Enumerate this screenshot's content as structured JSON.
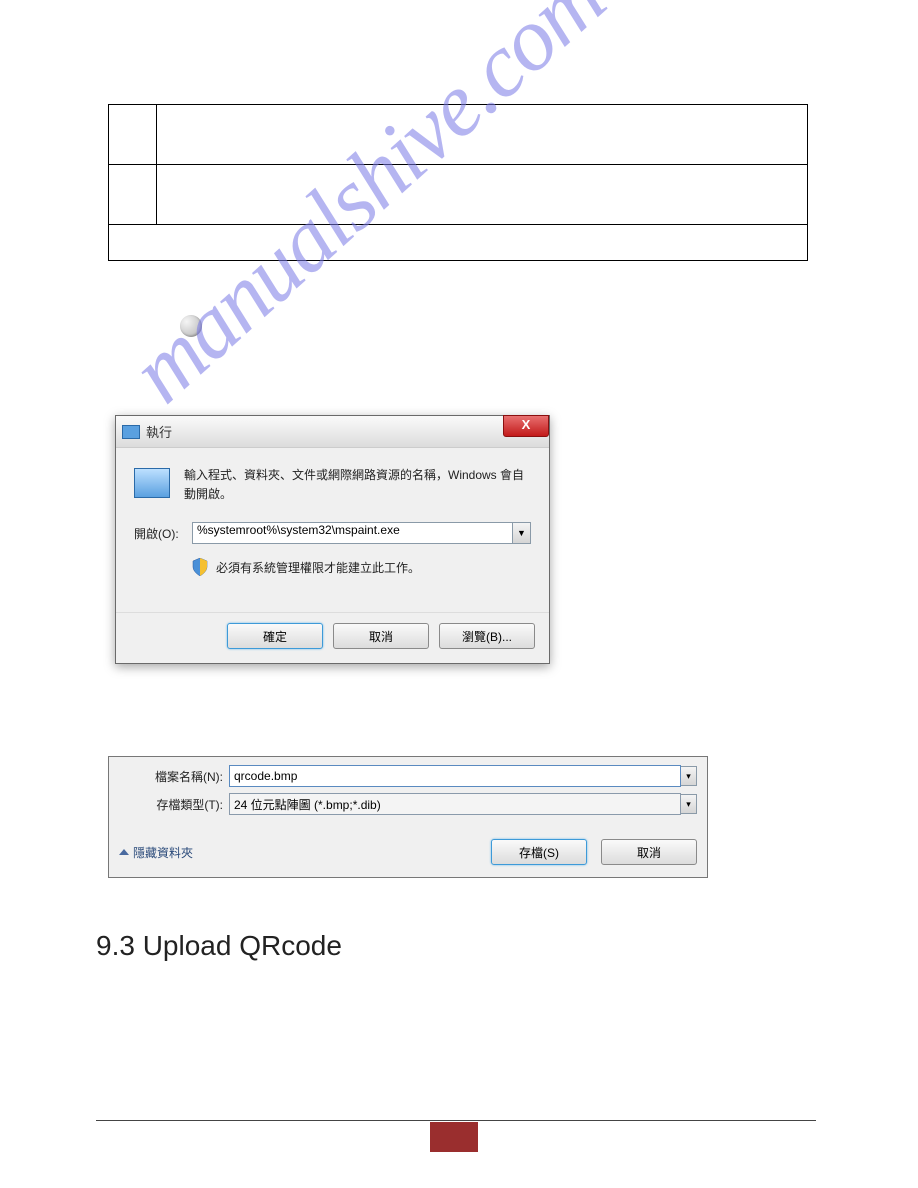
{
  "watermark": "manualshive.com",
  "run_dialog": {
    "title": "執行",
    "description": "輸入程式、資料夾、文件或網際網路資源的名稱，Windows 會自動開啟。",
    "open_label": "開啟(O):",
    "open_value": "%systemroot%\\system32\\mspaint.exe",
    "warning": "必須有系統管理權限才能建立此工作。",
    "ok": "確定",
    "cancel": "取消",
    "browse": "瀏覽(B)...",
    "close_x": "X"
  },
  "save_dialog": {
    "filename_label": "檔案名稱(N):",
    "filename_value": "qrcode.bmp",
    "filetype_label": "存檔類型(T):",
    "filetype_value": "24 位元點陣圖 (*.bmp;*.dib)",
    "hide_folders": "隱藏資料夾",
    "save": "存檔(S)",
    "cancel": "取消"
  },
  "heading": "9.3 Upload QRcode"
}
